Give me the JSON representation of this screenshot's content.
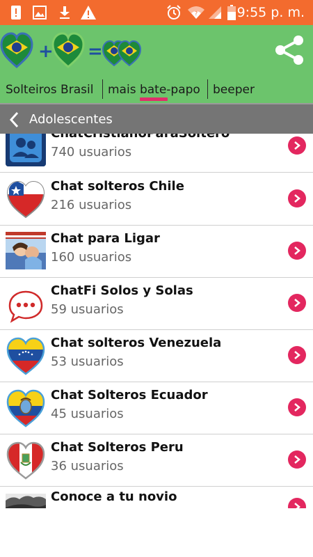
{
  "status_bar": {
    "icons": [
      "alert-card-icon",
      "image-icon",
      "download-icon",
      "warning-icon",
      "alarm-icon",
      "wifi-icon",
      "signal-icon",
      "battery-icon"
    ],
    "time": "9:55 p. m."
  },
  "header": {
    "logo_icons": [
      "brazil-heart-icon",
      "plus-icon",
      "brazil-heart-icon",
      "equals-icon",
      "brazil-hearts-pair-icon"
    ],
    "share_icon": "share-icon",
    "tabs": [
      {
        "label": "Solteiros Brasil",
        "active": false
      },
      {
        "label": "mais bate-papo",
        "active": true
      },
      {
        "label": "beeper",
        "active": false
      }
    ],
    "accent_color": "#e0306a",
    "header_color": "#6cc46c"
  },
  "subheader": {
    "back_icon": "chevron-left-icon",
    "title": "Adolescentes"
  },
  "rooms": [
    {
      "title": "ChatCristianoParaSoltero",
      "count": "740 usuarios",
      "icon": "chat-users-icon"
    },
    {
      "title": "Chat solteros Chile",
      "count": "216 usuarios",
      "icon": "chile-heart-icon"
    },
    {
      "title": "Chat para Ligar",
      "count": "160 usuarios",
      "icon": "couple-photo"
    },
    {
      "title": "ChatFi Solos y Solas",
      "count": "59 usuarios",
      "icon": "speech-bubble-icon"
    },
    {
      "title": "Chat solteros Venezuela",
      "count": "53 usuarios",
      "icon": "venezuela-heart-icon"
    },
    {
      "title": "Chat Solteros Ecuador",
      "count": "45 usuarios",
      "icon": "ecuador-heart-icon"
    },
    {
      "title": "Chat Solteros Peru",
      "count": "36 usuarios",
      "icon": "peru-heart-icon"
    },
    {
      "title": "Conoce a tu novio",
      "count": "",
      "icon": "photo-thumb"
    }
  ],
  "row_action_icon": "chevron-right-circle-icon"
}
